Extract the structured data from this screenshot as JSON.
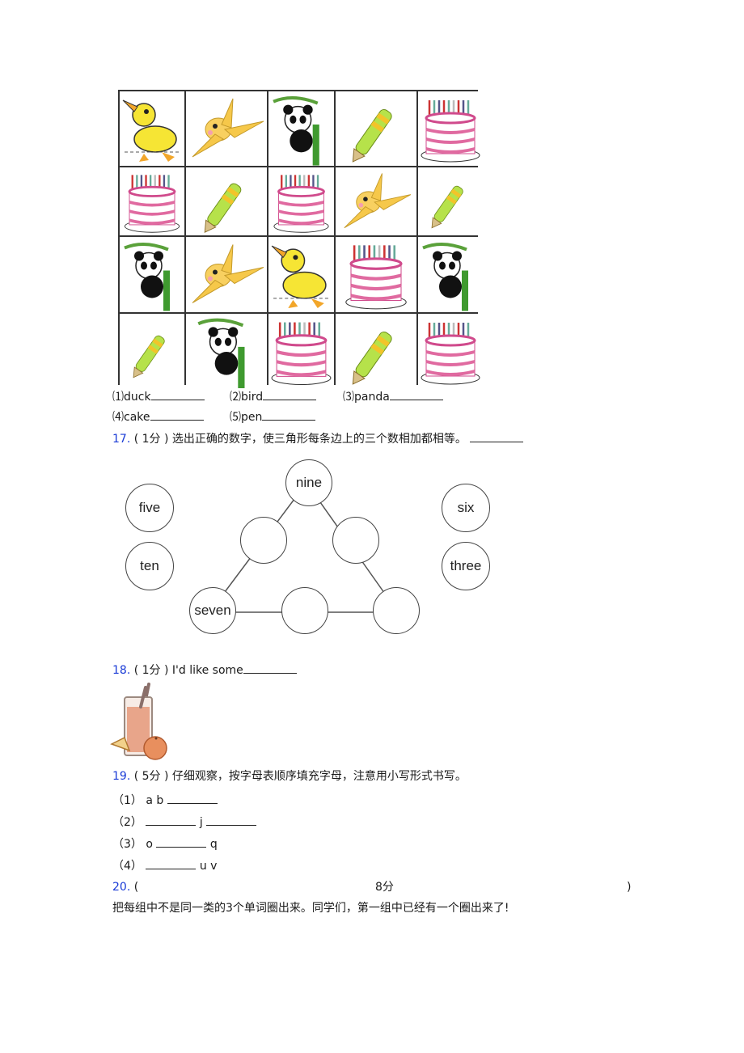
{
  "picture_grid": {
    "rows": [
      [
        "duck",
        "bird",
        "panda",
        "pen",
        "cake"
      ],
      [
        "cake",
        "pen",
        "cake",
        "bird",
        "pen"
      ],
      [
        "panda",
        "bird",
        "duck",
        "cake",
        "panda"
      ],
      [
        "pen",
        "panda",
        "cake",
        "pen",
        "cake"
      ]
    ],
    "count_items": [
      {
        "num": "⑴",
        "word": "duck"
      },
      {
        "num": "⑵",
        "word": "bird"
      },
      {
        "num": "⑶",
        "word": "panda"
      },
      {
        "num": "⑷",
        "word": "cake"
      },
      {
        "num": "⑸",
        "word": "pen"
      }
    ]
  },
  "q17": {
    "number": "17.",
    "score": "( 1分 )",
    "text": "选出正确的数字，使三角形每条边上的三个数相加都相等。",
    "options_left": [
      "five",
      "ten"
    ],
    "options_right": [
      "six",
      "three"
    ],
    "triangle": {
      "top": "nine",
      "left_mid": "",
      "right_mid": "",
      "bottom_left": "seven",
      "bottom_mid": "",
      "bottom_right": ""
    }
  },
  "q18": {
    "number": "18.",
    "score": "( 1分 )",
    "text": "I'd like some",
    "image": "orange-juice-glass"
  },
  "q19": {
    "number": "19.",
    "score": "( 5分 )",
    "text": "仔细观察，按字母表顺序填充字母，注意用小写形式书写。",
    "items": [
      {
        "label": "（1）",
        "before": "a b",
        "after": ""
      },
      {
        "label": "（2）",
        "before": "",
        "mid": "j",
        "after": ""
      },
      {
        "label": "（3）",
        "before": "o",
        "after": "q"
      },
      {
        "label": "（4）",
        "before": "",
        "after": "u v"
      }
    ]
  },
  "q20": {
    "number": "20.",
    "open": "(",
    "score": "8分",
    "close": ")",
    "text": "把每组中不是同一类的3个单词圈出来。同学们，第一组中已经有一个圈出来了!"
  },
  "colors": {
    "question_number": "#1a3bd6"
  }
}
